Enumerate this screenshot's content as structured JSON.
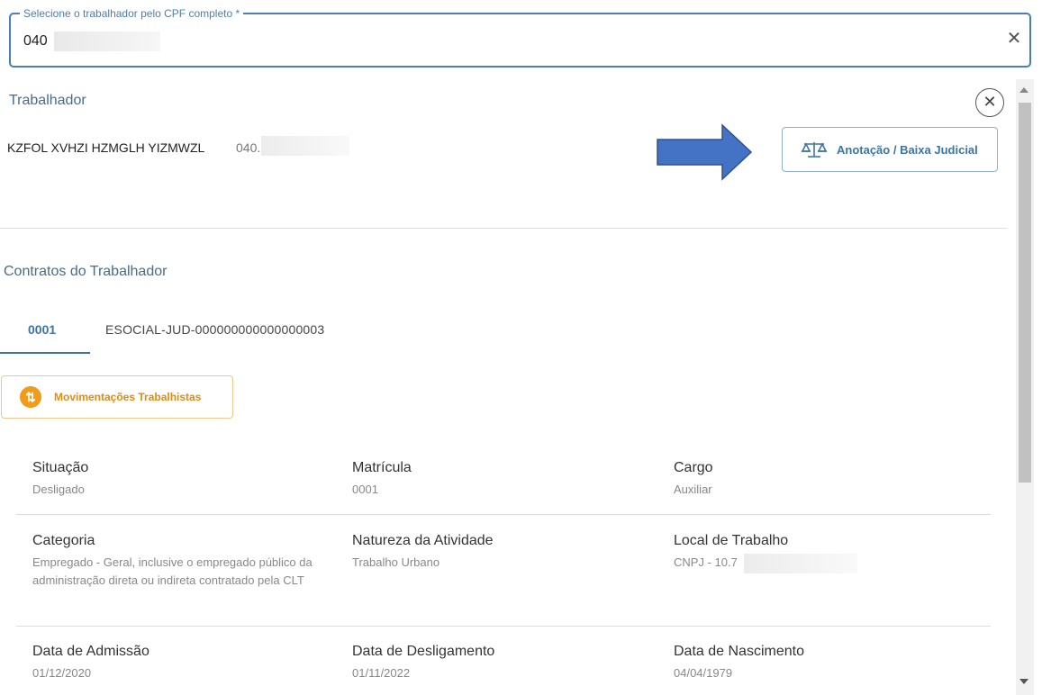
{
  "cpf_field": {
    "label": "Selecione o trabalhador pelo CPF completo *",
    "value": "040",
    "clear_glyph": "✕"
  },
  "worker": {
    "section_title": "Trabalhador",
    "name": "KZFOL XVHZI HZMGLH YIZMWZL",
    "cpf": "040.",
    "close_glyph": "✕",
    "judicial_button": "Anotação / Baixa Judicial"
  },
  "contracts": {
    "section_title": "Contratos do Trabalhador",
    "tabs": [
      {
        "label": "0001",
        "active": true
      },
      {
        "label": "ESOCIAL-JUD-000000000000000003",
        "active": false
      }
    ],
    "movements_button": "Movimentações Trabalhistas",
    "movements_icon": "⇅"
  },
  "details": {
    "situacao": {
      "label": "Situação",
      "value": "Desligado"
    },
    "matricula": {
      "label": "Matrícula",
      "value": "0001"
    },
    "cargo": {
      "label": "Cargo",
      "value": "Auxiliar"
    },
    "categoria": {
      "label": "Categoria",
      "value": "Empregado - Geral, inclusive o empregado público da administração direta ou indireta contratado pela CLT"
    },
    "natureza": {
      "label": "Natureza da Atividade",
      "value": "Trabalho Urbano"
    },
    "local": {
      "label": "Local de Trabalho",
      "value": "CNPJ - 10.7"
    },
    "admissao": {
      "label": "Data de Admissão",
      "value": "01/12/2020"
    },
    "desligamento": {
      "label": "Data de Desligamento",
      "value": "01/11/2022"
    },
    "nascimento": {
      "label": "Data de Nascimento",
      "value": "04/04/1979"
    }
  },
  "icons": {
    "balance": "balance-scale-icon",
    "arrow": "right-arrow-icon",
    "movements": "up-down-arrows-icon"
  },
  "colors": {
    "primary": "#3d73a8",
    "accent_orange": "#f29b1a",
    "annotation_arrow": "#4472c4"
  }
}
